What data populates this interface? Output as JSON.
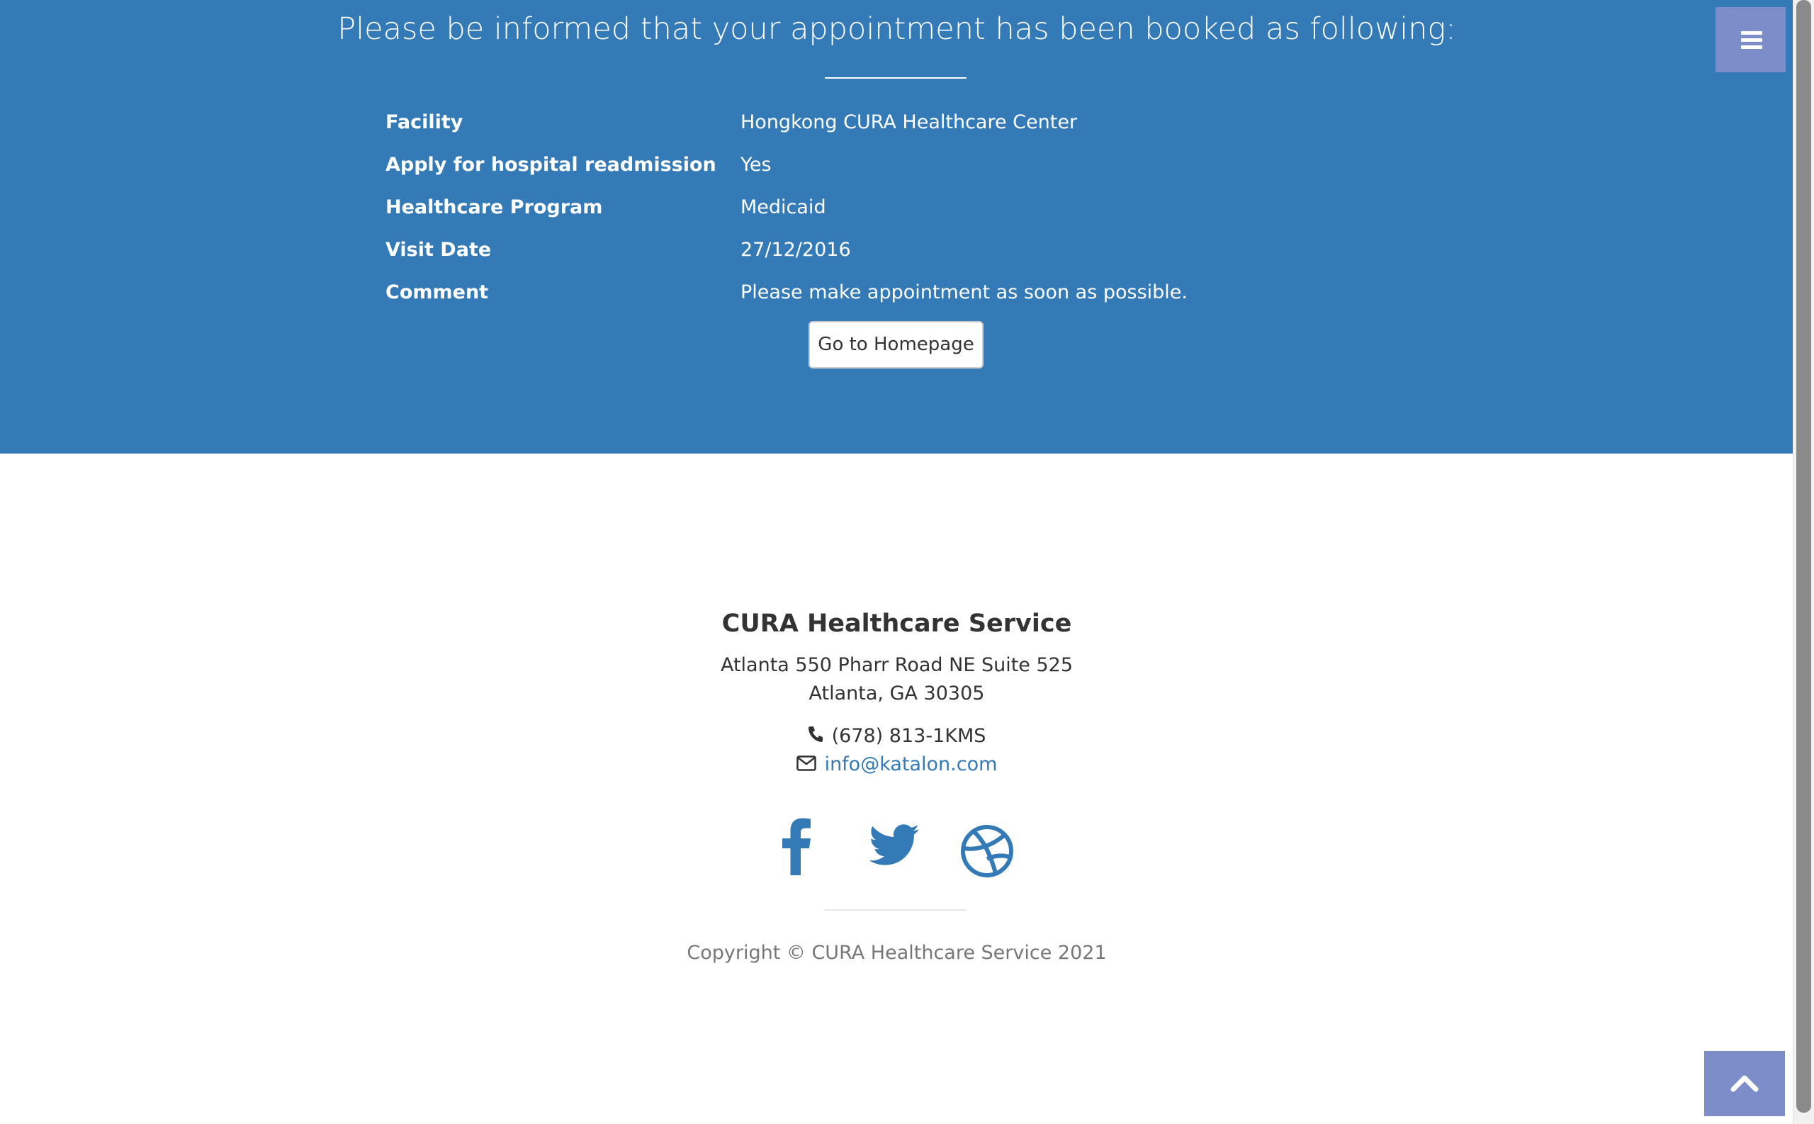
{
  "summary": {
    "title": "Please be informed that your appointment has been booked as following:",
    "details": [
      {
        "label": "Facility",
        "value": "Hongkong CURA Healthcare Center"
      },
      {
        "label": "Apply for hospital readmission",
        "value": "Yes"
      },
      {
        "label": "Healthcare Program",
        "value": "Medicaid"
      },
      {
        "label": "Visit Date",
        "value": "27/12/2016"
      },
      {
        "label": "Comment",
        "value": "Please make appointment as soon as possible."
      }
    ],
    "home_button_label": "Go to Homepage"
  },
  "menu": {
    "icon": "hamburger-menu-icon"
  },
  "footer": {
    "company": "CURA Healthcare Service",
    "address_line1": "Atlanta 550 Pharr Road NE Suite 525",
    "address_line2": "Atlanta, GA 30305",
    "phone": "(678) 813-1KMS",
    "email": "info@katalon.com",
    "social": [
      {
        "icon": "facebook-icon"
      },
      {
        "icon": "twitter-icon"
      },
      {
        "icon": "dribbble-icon"
      }
    ],
    "copyright": "Copyright © CURA Healthcare Service 2021"
  },
  "scroll_top": {
    "icon": "chevron-up-icon"
  },
  "colors": {
    "primary_blue": "#337ab7",
    "accent_violet": "#7d8dca",
    "text_dark": "#333333",
    "text_muted": "#777777"
  }
}
